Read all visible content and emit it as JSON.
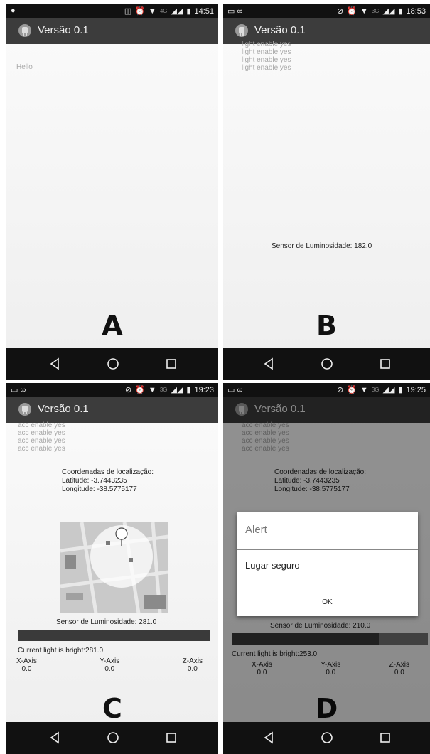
{
  "app_title": "Versão 0.1",
  "nav": {
    "back_icon": "back-triangle-icon",
    "home_icon": "home-circle-icon",
    "recents_icon": "recents-square-icon"
  },
  "panels": {
    "a": {
      "letter": "A",
      "time": "14:51",
      "network": "4G",
      "greeting": "Hello"
    },
    "b": {
      "letter": "B",
      "time": "18:53",
      "network": "3G",
      "log_partial": "light enable yes",
      "log_lines": [
        "light enable yes",
        "light enable yes",
        "light enable yes"
      ],
      "sensor_text": "Sensor de Luminosidade: 182.0"
    },
    "c": {
      "letter": "C",
      "time": "19:23",
      "network": "3G",
      "log_partial": "acc enable yes",
      "log_lines": [
        "acc enable yes",
        "acc enable yes",
        "acc enable yes"
      ],
      "coords_title": "Coordenadas de localização:",
      "latitude": "Latitude: -3.7443235",
      "longitude": "Longitude: -38.5775177",
      "sensor_text": "Sensor de Luminosidade: 281.0",
      "light_progress": 1.0,
      "light_text": "Current light is bright:281.0",
      "axes": [
        {
          "label": "X-Axis",
          "value": "0.0"
        },
        {
          "label": "Y-Axis",
          "value": "0.0"
        },
        {
          "label": "Z-Axis",
          "value": "0.0"
        }
      ]
    },
    "d": {
      "letter": "D",
      "time": "19:25",
      "network": "3G",
      "log_partial": "acc enable yes",
      "log_lines": [
        "acc enable yes",
        "acc enable yes",
        "acc enable yes"
      ],
      "coords_title": "Coordenadas de localização:",
      "latitude": "Latitude: -3.7443235",
      "longitude": "Longitude: -38.5775177",
      "sensor_text": "Sensor de Luminosidade: 210.0",
      "light_progress": 0.75,
      "light_text": "Current light is bright:253.0",
      "axes": [
        {
          "label": "X-Axis",
          "value": "0.0"
        },
        {
          "label": "Y-Axis",
          "value": "0.0"
        },
        {
          "label": "Z-Axis",
          "value": "0.0"
        }
      ],
      "dialog": {
        "title": "Alert",
        "message": "Lugar seguro",
        "ok_label": "OK"
      }
    }
  },
  "colors": {
    "appbar": "#3c3c3c",
    "bars": "#111111",
    "progress_fill": "#3a3a3a",
    "progress_track": "#707070"
  }
}
